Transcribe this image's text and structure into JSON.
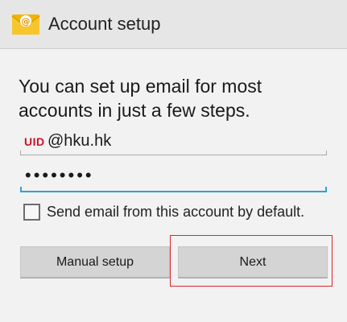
{
  "header": {
    "title": "Account setup",
    "icon": "email-app-icon"
  },
  "main": {
    "instruction": "You can set up email for most accounts in just a few steps.",
    "email_field": {
      "uid_tag": "UID",
      "value": "@hku.hk"
    },
    "password_field": {
      "value": "••••••••"
    },
    "default_checkbox": {
      "label": "Send email from this account by default.",
      "checked": false
    },
    "buttons": {
      "manual_setup": "Manual setup",
      "next": "Next"
    }
  },
  "colors": {
    "action_bar": "#e6e6e6",
    "background": "#f2f2f2",
    "focus_underline": "#2ea2d6",
    "uid_tag": "#d0102a",
    "highlight": "#e2242c",
    "button": "#d4d4d4"
  }
}
